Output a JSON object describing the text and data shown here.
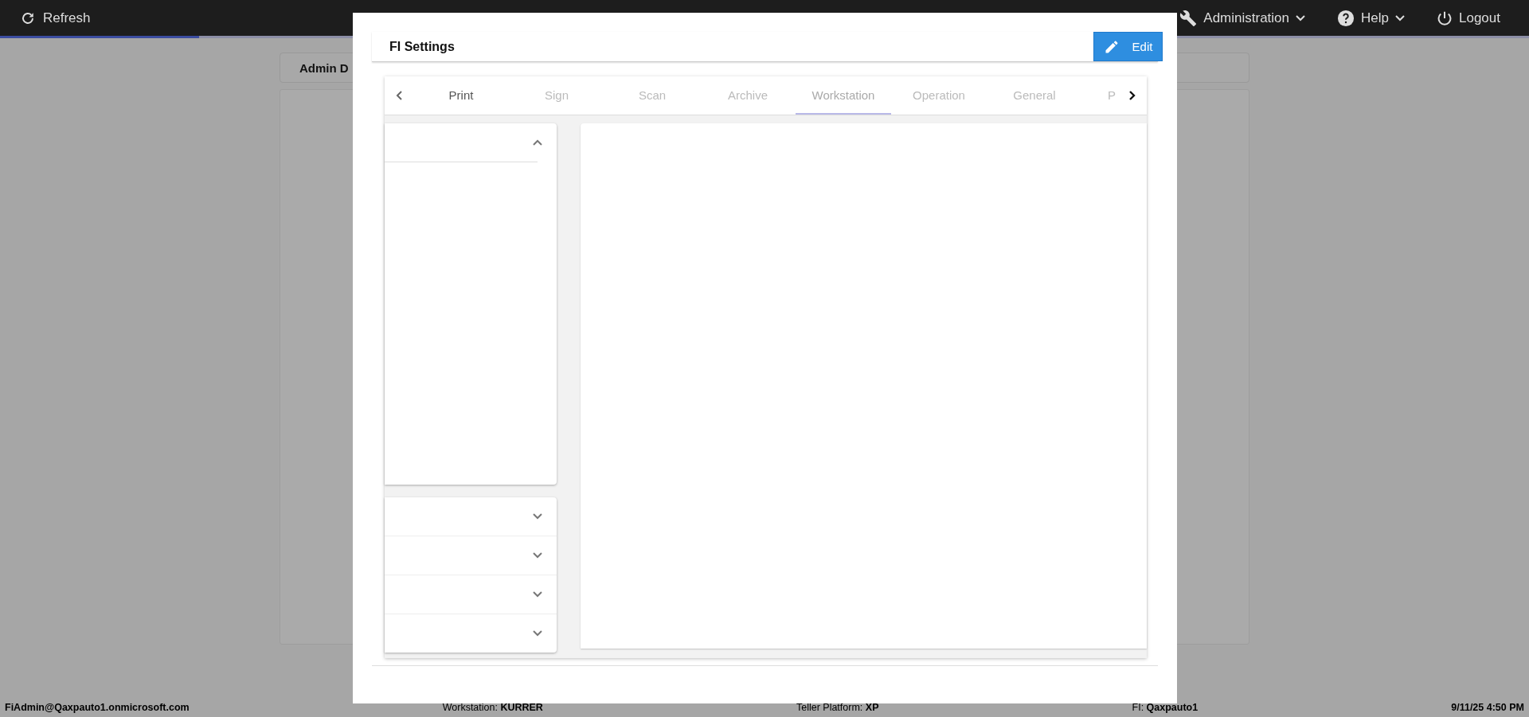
{
  "top_bar": {
    "refresh": "Refresh",
    "menus": [
      {
        "kind": "admin",
        "label": "Administration",
        "dropdown": true
      },
      {
        "kind": "help",
        "label": "Help",
        "dropdown": true
      },
      {
        "kind": "logout",
        "label": "Logout",
        "dropdown": false
      }
    ],
    "progress": {
      "level": 0.13
    }
  },
  "page": {
    "card_title": "Admin D"
  },
  "dialog": {
    "title": "FI Settings",
    "edit_button": "Edit",
    "tabs": [
      {
        "label": "Print",
        "selected": false
      },
      {
        "label": "Sign",
        "selected": false
      },
      {
        "label": "Scan",
        "selected": false
      },
      {
        "label": "Archive",
        "selected": false
      },
      {
        "label": "Workstation",
        "selected": true
      },
      {
        "label": "Operation",
        "selected": false
      },
      {
        "label": "General",
        "selected": false
      },
      {
        "label": "P",
        "selected": false
      }
    ],
    "accordion": [
      {
        "expanded": true
      },
      {
        "expanded": false
      },
      {
        "expanded": false
      },
      {
        "expanded": false
      },
      {
        "expanded": false
      }
    ]
  },
  "status_bar": [
    "FiAdmin@Qaxpauto1.onmicrosoft.com",
    "Workstation: **KURRER**",
    "Teller Platform: **XP**",
    "FI: **Qaxpauto1**",
    "9/11/25 4:50 PM"
  ]
}
